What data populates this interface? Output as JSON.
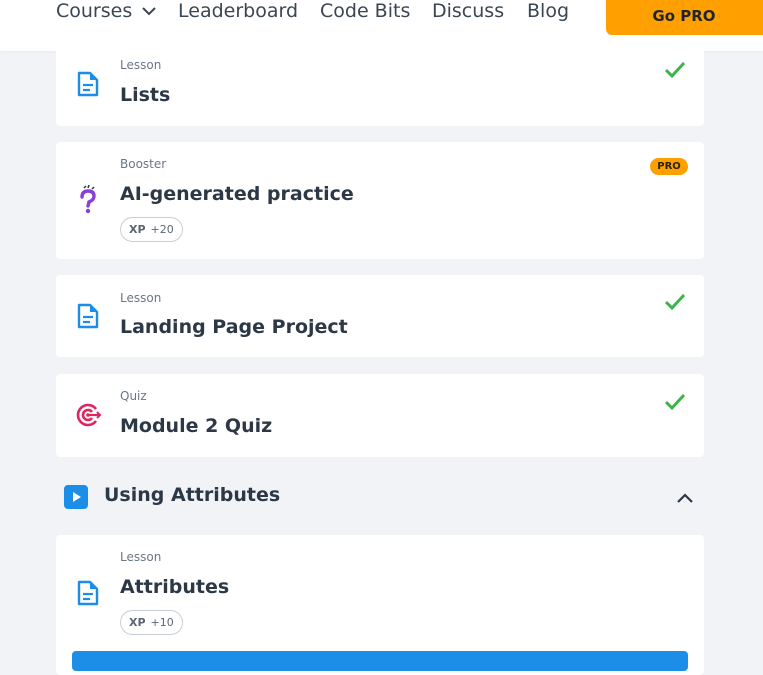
{
  "nav": {
    "courses": "Courses",
    "leaderboard": "Leaderboard",
    "code_bits": "Code Bits",
    "discuss": "Discuss",
    "blog": "Blog",
    "go_pro": "Go PRO"
  },
  "items": [
    {
      "kind": "Lesson",
      "title": "Lists",
      "completed": true,
      "icon": "lesson-icon"
    },
    {
      "kind": "Booster",
      "title": "AI-generated practice",
      "badge": "PRO",
      "xp_label": "XP",
      "xp_value": "+20",
      "icon": "question-mark-icon"
    },
    {
      "kind": "Lesson",
      "title": "Landing Page Project",
      "completed": true,
      "icon": "lesson-icon"
    },
    {
      "kind": "Quiz",
      "title": "Module 2 Quiz",
      "completed": true,
      "icon": "target-icon"
    }
  ],
  "section": {
    "title": "Using Attributes",
    "expanded": true,
    "items": [
      {
        "kind": "Lesson",
        "title": "Attributes",
        "xp_label": "XP",
        "xp_value": "+10",
        "icon": "lesson-icon"
      }
    ]
  },
  "colors": {
    "accent_blue": "#1d8ee8",
    "pro_orange": "#ffa000",
    "check_green": "#3bb54a",
    "quiz_red": "#e0245e",
    "booster_purple": "#8b3fd9"
  }
}
